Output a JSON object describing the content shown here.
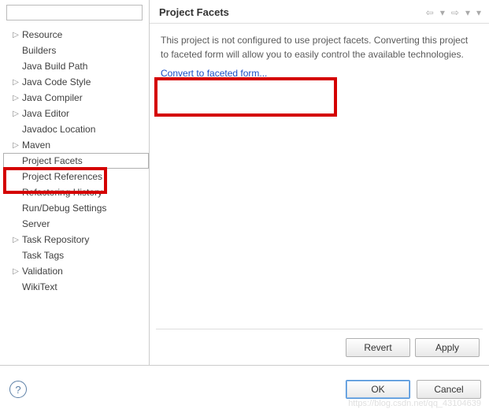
{
  "sidebar": {
    "filter_placeholder": "",
    "items": [
      {
        "label": "Resource",
        "expandable": true
      },
      {
        "label": "Builders",
        "expandable": false
      },
      {
        "label": "Java Build Path",
        "expandable": false
      },
      {
        "label": "Java Code Style",
        "expandable": true
      },
      {
        "label": "Java Compiler",
        "expandable": true
      },
      {
        "label": "Java Editor",
        "expandable": true
      },
      {
        "label": "Javadoc Location",
        "expandable": false
      },
      {
        "label": "Maven",
        "expandable": true
      },
      {
        "label": "Project Facets",
        "expandable": false,
        "selected": true
      },
      {
        "label": "Project References",
        "expandable": false
      },
      {
        "label": "Refactoring History",
        "expandable": false
      },
      {
        "label": "Run/Debug Settings",
        "expandable": false
      },
      {
        "label": "Server",
        "expandable": false
      },
      {
        "label": "Task Repository",
        "expandable": true
      },
      {
        "label": "Task Tags",
        "expandable": false
      },
      {
        "label": "Validation",
        "expandable": true
      },
      {
        "label": "WikiText",
        "expandable": false
      }
    ]
  },
  "main": {
    "title": "Project Facets",
    "description": "This project is not configured to use project facets. Converting this project to faceted form will allow you to easily control the available technologies.",
    "convert_link": "Convert to faceted form...",
    "revert_label": "Revert",
    "apply_label": "Apply"
  },
  "bottom": {
    "ok_label": "OK",
    "cancel_label": "Cancel"
  },
  "watermark": "https://blog.csdn.net/qq_43104639"
}
